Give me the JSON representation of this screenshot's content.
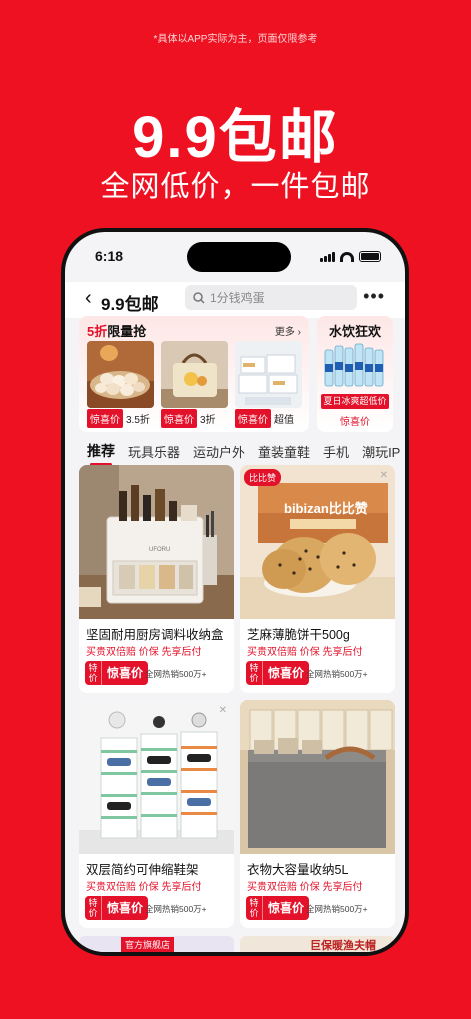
{
  "promo": {
    "disclaimer": "*具体以APP实际为主，页面仅限参考",
    "title": "9.9包邮",
    "subtitle": "全网低价，一件包邮"
  },
  "status_bar": {
    "time": "6:18"
  },
  "nav": {
    "back_icon": "chevron-left-icon",
    "title": "9.9包邮",
    "search_placeholder": "1分钱鸡蛋",
    "more_icon": "more-icon"
  },
  "flash_sale": {
    "title_highlight": "5折",
    "title_rest": "限量抢",
    "more": "更多 ›",
    "items": [
      {
        "label": "惊喜价",
        "value": "3.5折",
        "image": "eggs"
      },
      {
        "label": "惊喜价",
        "value": "3折",
        "image": "handbag"
      },
      {
        "label": "惊喜价",
        "value": "超值",
        "image": "tissues"
      }
    ]
  },
  "drinks": {
    "title": "水饮狂欢",
    "badge": "夏日冰爽超低价",
    "price_label": "惊喜价"
  },
  "tabs": [
    "推荐",
    "玩具乐器",
    "运动户外",
    "童装童鞋",
    "手机",
    "潮玩IP"
  ],
  "products": [
    {
      "title": "坚固耐用厨房调料收纳盒",
      "guarantee": "买贵双倍赔  价保  先享后付",
      "tag": "特价",
      "price_label": "惊喜价",
      "sales": "全网热销500万+",
      "image": "spice-rack"
    },
    {
      "title": "芝麻薄脆饼干500g",
      "guarantee": "买贵双倍赔  价保  先享后付",
      "tag": "特价",
      "price_label": "惊喜价",
      "sales": "全网热销500万+",
      "image": "biscuits",
      "brand": "bibizan比比赞",
      "brand_badge": "比比赞"
    },
    {
      "title": "双层简约可伸缩鞋架",
      "guarantee": "买贵双倍赔  价保  先享后付",
      "tag": "特价",
      "price_label": "惊喜价",
      "sales": "全网热销500万+",
      "image": "shoe-rack"
    },
    {
      "title": "衣物大容量收纳5L",
      "guarantee": "买贵双倍赔  价保  先享后付",
      "tag": "特价",
      "price_label": "惊喜价",
      "sales": "全网热销500万+",
      "image": "storage-box"
    }
  ],
  "peek": {
    "left_text": "官方旗舰店",
    "right_text": "巨保暖渔夫帽"
  },
  "colors": {
    "brand_red": "#e3112a",
    "background_red": "#ee1122"
  }
}
